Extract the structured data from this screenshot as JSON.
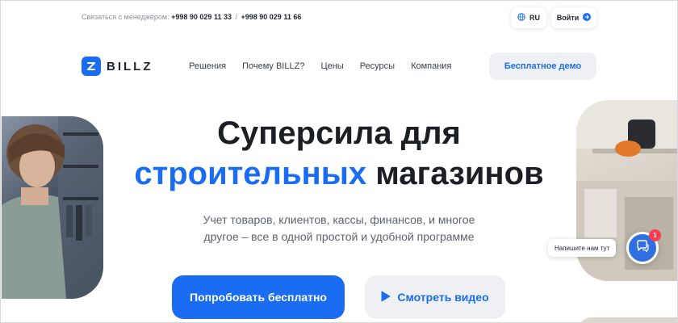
{
  "topbar": {
    "contact_label": "Связаться с менеджером:",
    "phone_1": "+998 90 029 11 33",
    "separator": "/",
    "phone_2": "+998 90 029 11 66",
    "language": "RU",
    "language_icon": "globe-icon",
    "login_label": "Войти",
    "login_icon": "arrow-right-circle-icon"
  },
  "nav": {
    "logo_text": "BILLZ",
    "items": [
      "Решения",
      "Почему BILLZ?",
      "Цены",
      "Ресурсы",
      "Компания"
    ],
    "demo_label": "Бесплатное демо"
  },
  "hero": {
    "title_line1": "Суперсила для",
    "title_accent": "строительных",
    "title_rest": "магазинов",
    "subtitle_line1": "Учет товаров, клиентов, кассы, финансов, и многое",
    "subtitle_line2": "другое – все в одной простой и удобной программе",
    "try_label": "Попробовать бесплатно",
    "video_label": "Смотреть видео",
    "video_icon": "play-icon"
  },
  "chat": {
    "tooltip": "Напишите нам тут",
    "badge_count": "1",
    "icon": "chat-bubble-icon"
  },
  "colors": {
    "brand": "#1a6cf2",
    "text_dark": "#1b1e24",
    "badge": "#ff3b4e"
  }
}
